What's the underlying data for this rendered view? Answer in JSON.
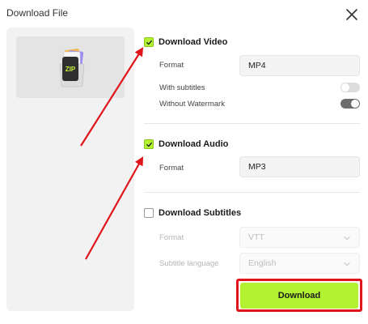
{
  "dialog": {
    "title": "Download File"
  },
  "video": {
    "label": "Download Video",
    "checked": true,
    "format_label": "Format",
    "format_value": "MP4",
    "subtitles_label": "With subtitles",
    "subtitles_on": false,
    "watermark_label": "Without Watermark",
    "watermark_on": true
  },
  "audio": {
    "label": "Download Audio",
    "checked": true,
    "format_label": "Format",
    "format_value": "MP3"
  },
  "subtitles": {
    "label": "Download Subtitles",
    "checked": false,
    "format_label": "Format",
    "format_value": "VTT",
    "language_label": "Subtitle language",
    "language_value": "English"
  },
  "thumbnail": {
    "icon": "zip-file-icon",
    "text": "ZIP"
  },
  "actions": {
    "download_label": "Download"
  },
  "colors": {
    "accent": "#b2f233",
    "annotation": "#e0141b",
    "toggle_on": "#6d6d6d",
    "toggle_off": "#dcdcdc"
  }
}
